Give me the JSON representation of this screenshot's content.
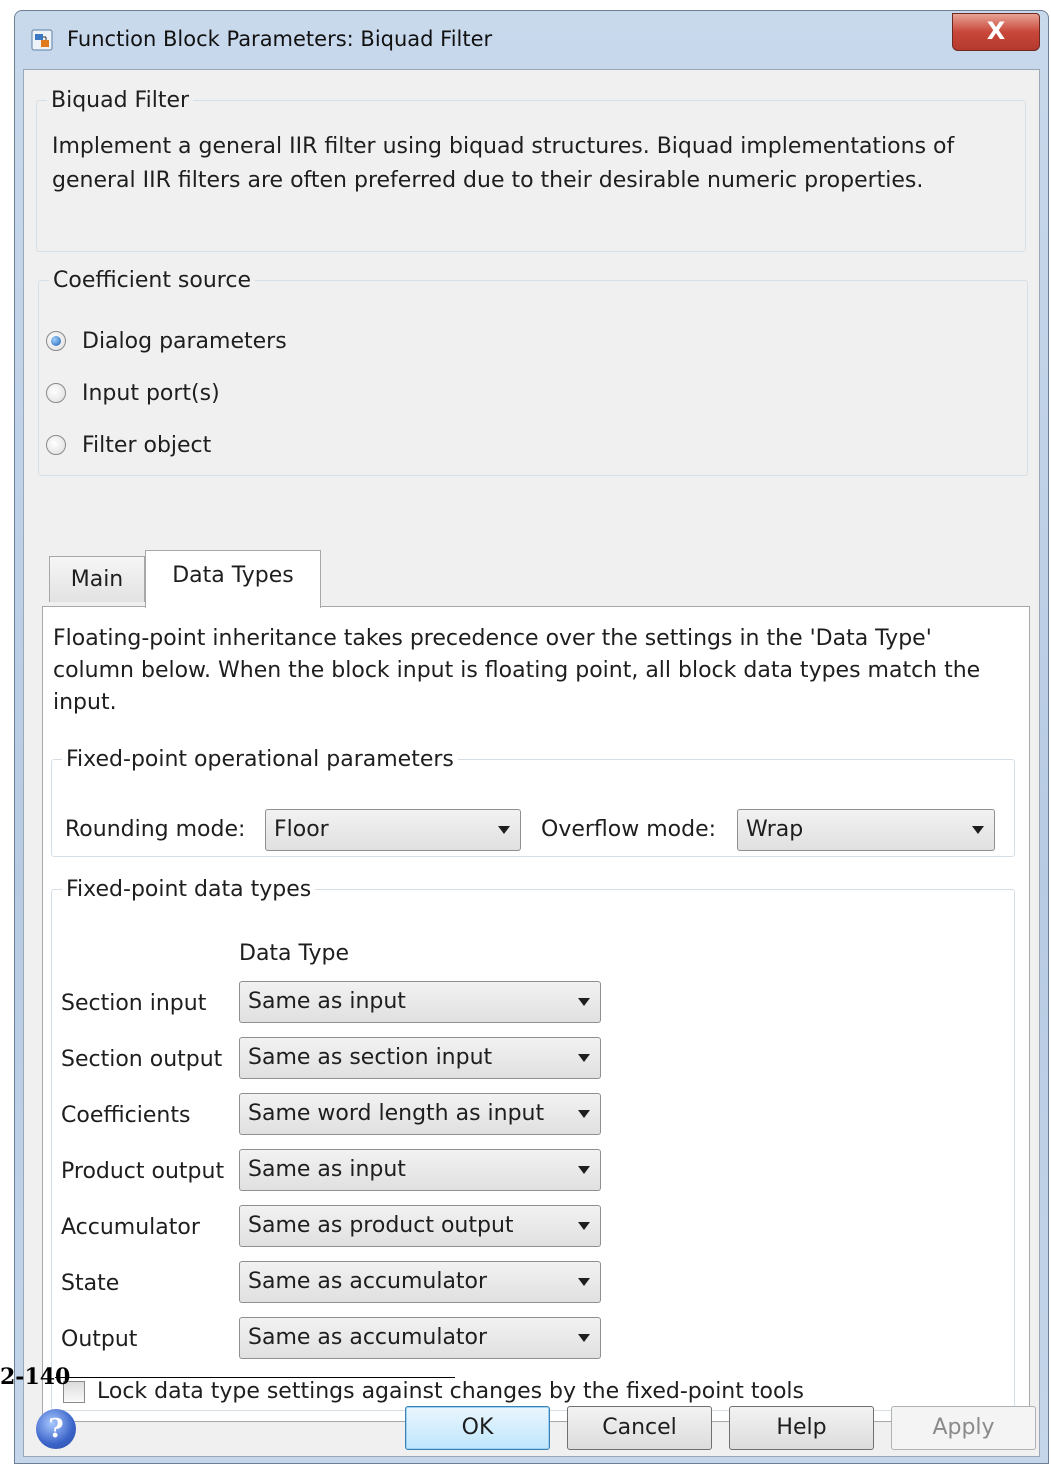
{
  "window": {
    "title": "Function Block Parameters: Biquad Filter",
    "close_label": "X"
  },
  "block_group": {
    "legend": "Biquad Filter",
    "description": "Implement a general IIR filter using biquad structures. Biquad implementations of general IIR filters are often preferred due to their desirable numeric properties."
  },
  "coefficient_source": {
    "legend": "Coefficient source",
    "options": [
      {
        "label": "Dialog parameters",
        "selected": true
      },
      {
        "label": "Input port(s)",
        "selected": false
      },
      {
        "label": "Filter object",
        "selected": false
      }
    ]
  },
  "tabs": [
    {
      "label": "Main",
      "active": false
    },
    {
      "label": "Data Types",
      "active": true
    }
  ],
  "data_types": {
    "note": "Floating-point inheritance takes precedence over the settings in the 'Data Type' column below. When the block input is floating point, all block data types match the input.",
    "operational": {
      "legend": "Fixed-point operational parameters",
      "rounding_label": "Rounding mode:",
      "rounding_value": "Floor",
      "overflow_label": "Overflow mode:",
      "overflow_value": "Wrap"
    },
    "fixed_point": {
      "legend": "Fixed-point data types",
      "column_header": "Data Type",
      "rows": [
        {
          "label": "Section input",
          "value": "Same as input"
        },
        {
          "label": "Section output",
          "value": "Same as section input"
        },
        {
          "label": "Coefficients",
          "value": "Same word length as input"
        },
        {
          "label": "Product output",
          "value": "Same as input"
        },
        {
          "label": "Accumulator",
          "value": "Same as product output"
        },
        {
          "label": "State",
          "value": "Same as accumulator"
        },
        {
          "label": "Output",
          "value": "Same as accumulator"
        }
      ],
      "lock_label": "Lock data type settings against changes by the fixed-point tools",
      "lock_checked": false
    }
  },
  "page_number": "2-140",
  "buttons": {
    "help_icon": "?",
    "ok": "OK",
    "cancel": "Cancel",
    "help": "Help",
    "apply": "Apply"
  }
}
